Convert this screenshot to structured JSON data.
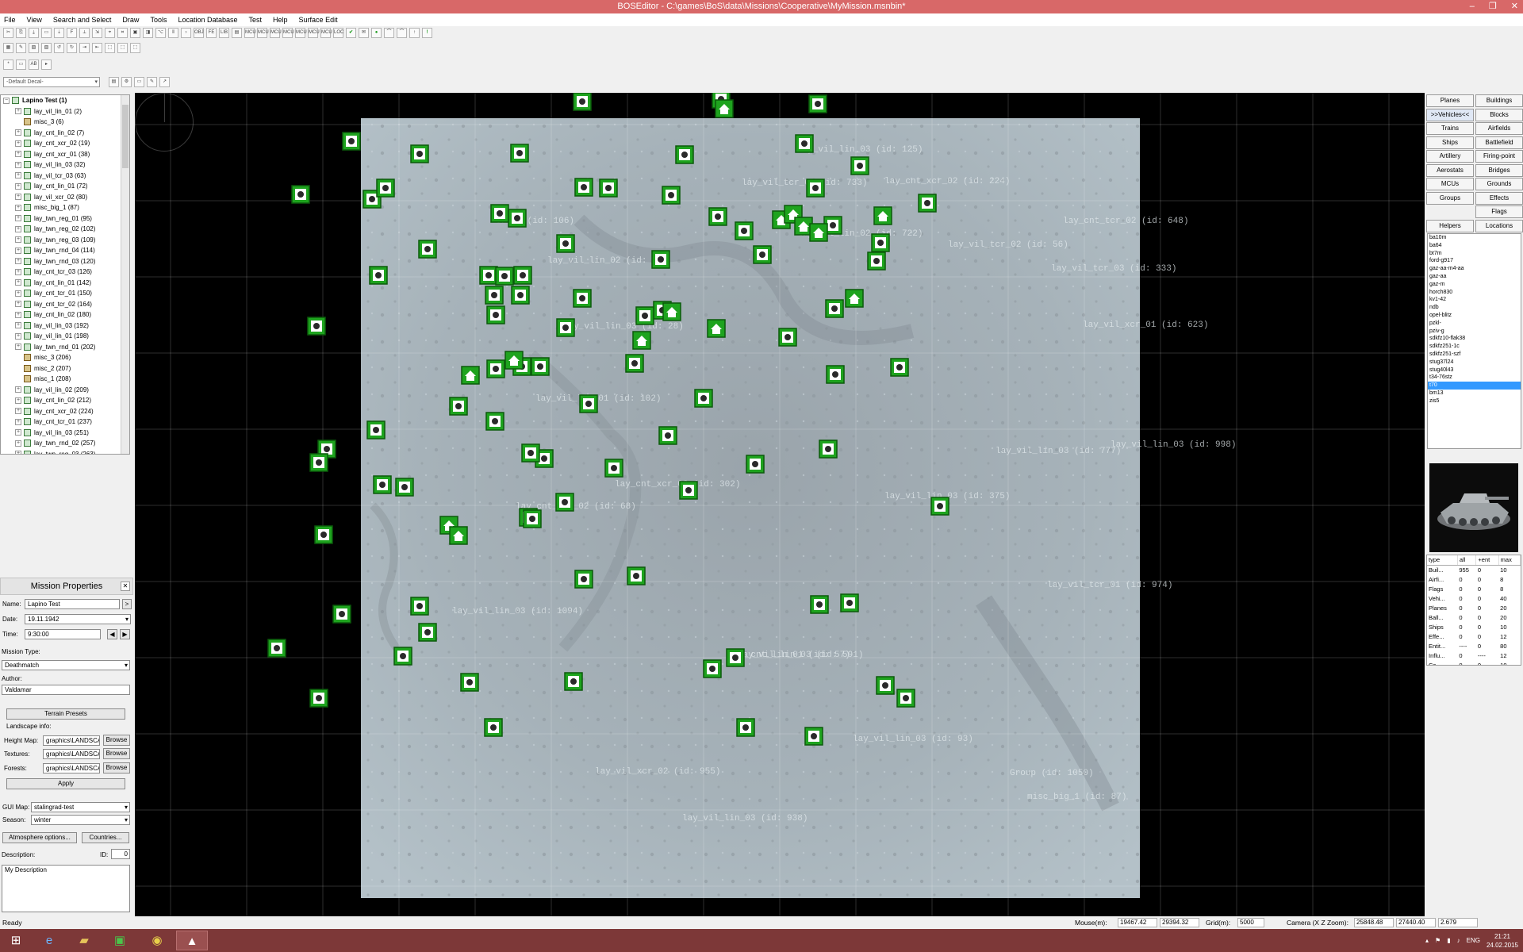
{
  "window": {
    "title": "BOSEditor - C:\\games\\BoS\\data\\Missions\\Cooperative\\MyMission.msnbin*",
    "buttons": [
      "–",
      "❐",
      "✕"
    ]
  },
  "menu": [
    "File",
    "View",
    "Search and Select",
    "Draw",
    "Tools",
    "Location Database",
    "Test",
    "Help",
    "Surface Edit"
  ],
  "toolbar1": [
    "✂",
    "⎘",
    "⤓",
    "▭",
    "⇣",
    "F",
    "⟂",
    "⇲",
    "⌖",
    "⌗",
    "▣",
    "◨",
    "⌥",
    "⫴",
    "›",
    "OBJ",
    "FE",
    "LIB",
    "▤",
    "MCU",
    "MCU",
    "MCU",
    "MCU",
    "MCU",
    "MCU",
    "MCU",
    "LOC",
    "✔",
    "✉",
    "●",
    "⌒",
    "⌒",
    "↑",
    "!"
  ],
  "toolbar2": [
    "▦",
    "✎",
    "▨",
    "▧",
    "↺",
    "↻",
    "⇥",
    "⇤",
    "⬚",
    "⬚",
    "⬚"
  ],
  "toolbar3": [
    "*",
    "▭",
    "AB",
    "▸"
  ],
  "decal_select": "-Default Decal-",
  "tree": {
    "root": "Lapino Test (1)",
    "items": [
      {
        "label": "lay_vil_lin_01 (2)",
        "exp": true
      },
      {
        "label": "misc_3 (6)",
        "exp": false
      },
      {
        "label": "lay_cnt_lin_02 (7)",
        "exp": true
      },
      {
        "label": "lay_cnt_xcr_02 (19)",
        "exp": true
      },
      {
        "label": "lay_cnt_xcr_01 (38)",
        "exp": true
      },
      {
        "label": "lay_vil_lin_03 (32)",
        "exp": true
      },
      {
        "label": "lay_vil_tcr_03 (63)",
        "exp": true
      },
      {
        "label": "lay_cnt_lin_01 (72)",
        "exp": true
      },
      {
        "label": "lay_vil_xcr_02 (80)",
        "exp": true
      },
      {
        "label": "misc_big_1 (87)",
        "exp": true
      },
      {
        "label": "lay_twn_reg_01 (95)",
        "exp": true
      },
      {
        "label": "lay_twn_reg_02 (102)",
        "exp": true
      },
      {
        "label": "lay_twn_reg_03 (109)",
        "exp": true
      },
      {
        "label": "lay_twn_rnd_04 (114)",
        "exp": true
      },
      {
        "label": "lay_twn_rnd_03 (120)",
        "exp": true
      },
      {
        "label": "lay_cnt_tcr_03 (126)",
        "exp": true
      },
      {
        "label": "lay_cnt_lin_01 (142)",
        "exp": true
      },
      {
        "label": "lay_cnt_tcr_01 (150)",
        "exp": true
      },
      {
        "label": "lay_cnt_tcr_02 (164)",
        "exp": true
      },
      {
        "label": "lay_cnt_lin_02 (180)",
        "exp": true
      },
      {
        "label": "lay_vil_lin_03 (192)",
        "exp": true
      },
      {
        "label": "lay_vil_lin_01 (198)",
        "exp": true
      },
      {
        "label": "lay_twn_rnd_01 (202)",
        "exp": true
      },
      {
        "label": "misc_3 (206)",
        "exp": false
      },
      {
        "label": "misc_2 (207)",
        "exp": false
      },
      {
        "label": "misc_1 (208)",
        "exp": false
      },
      {
        "label": "lay_vil_lin_02 (209)",
        "exp": true
      },
      {
        "label": "lay_cnt_lin_02 (212)",
        "exp": true
      },
      {
        "label": "lay_cnt_xcr_02 (224)",
        "exp": true
      },
      {
        "label": "lay_cnt_tcr_01 (237)",
        "exp": true
      },
      {
        "label": "lay_vil_lin_03 (251)",
        "exp": true
      },
      {
        "label": "lay_twn_rnd_02 (257)",
        "exp": true
      },
      {
        "label": "lay_twn_reg_03 (263)",
        "exp": true
      }
    ]
  },
  "mission_props": {
    "title": "Mission Properties",
    "name_label": "Name:",
    "name_value": "Lapino Test",
    "date_label": "Date:",
    "date_value": "19.11.1942",
    "time_label": "Time:",
    "time_value": "9:30:00",
    "mission_type_label": "Mission Type:",
    "mission_type_value": "Deathmatch",
    "author_label": "Author:",
    "author_value": "Valdamar",
    "terrain_presets": "Terrain Presets",
    "landscape_info": "Landscape info:",
    "height_map_label": "Height Map:",
    "height_map_value": "graphics\\LANDSCAPE",
    "textures_label": "Textures:",
    "textures_value": "graphics\\LANDSCAPE",
    "forests_label": "Forests:",
    "forests_value": "graphics\\LANDSCAPE",
    "browse": "Browse",
    "apply": "Apply",
    "gui_map_label": "GUI Map:",
    "gui_map_value": "stalingrad-test",
    "season_label": "Season:",
    "season_value": "winter",
    "atmosphere_button": "Atmosphere options...",
    "countries_button": "Countries...",
    "description_label": "Description:",
    "id_label": "ID:",
    "id_value": "0",
    "description_value": "My Description"
  },
  "categories": [
    [
      "Planes",
      "Buildings"
    ],
    [
      ">>Vehicles<<",
      "Blocks"
    ],
    [
      "Trains",
      "Airfields"
    ],
    [
      "Ships",
      "Battlefield"
    ],
    [
      "Artillery",
      "Firing-point"
    ],
    [
      "Aerostats",
      "Bridges"
    ],
    [
      "MCUs",
      "Grounds"
    ],
    [
      "Groups",
      "Effects"
    ],
    [
      "",
      "Flags"
    ],
    [
      "Helpers",
      "Locations"
    ]
  ],
  "vehicles": [
    "ba10m",
    "ba64",
    "bt7m",
    "ford-g917",
    "gaz-aa-m4-aa",
    "gaz-aa",
    "gaz-m",
    "horch830",
    "kv1-42",
    "ndb",
    "opel-blitz",
    "pzkl-",
    "pziv-g",
    "sdkfz10-flak38",
    "sdkfz251-1c",
    "sdkfz251-szf",
    "stug37l24",
    "stug40l43",
    "t34-76stz",
    "t70",
    "bm13",
    "zis5"
  ],
  "selected_vehicle": "t70",
  "stats": {
    "headers": [
      "type",
      "all",
      "+ent",
      "max"
    ],
    "rows": [
      [
        "Buil...",
        "955",
        "0",
        "10"
      ],
      [
        "Airfi...",
        "0",
        "0",
        "8"
      ],
      [
        "Flags",
        "0",
        "0",
        "8"
      ],
      [
        "Vehi...",
        "0",
        "0",
        "40"
      ],
      [
        "Planes",
        "0",
        "0",
        "20"
      ],
      [
        "Ball...",
        "0",
        "0",
        "20"
      ],
      [
        "Ships",
        "0",
        "0",
        "10"
      ],
      [
        "Effe...",
        "0",
        "0",
        "12"
      ],
      [
        "Entit...",
        "----",
        "0",
        "80"
      ],
      [
        "Influ...",
        "0",
        "----",
        "12"
      ],
      [
        "Ca...",
        "0",
        "0",
        "10"
      ]
    ]
  },
  "map_labels": [
    "lay_vil_lin_03 (id: 125)",
    "lay_vil_tcr_01 (id: 733)",
    "lay_cnt_xcr_02 (id: 224)",
    "lay_cnt_tcr_02 (id: 648)",
    "Group (id: 106)",
    "lay_vil_lin_02 (id: 722)",
    "lay_vil_tcr_02 (id: 56)",
    "lay_vil_lin_02 (id: 80)",
    "lay_vil_tcr_03 (id: 333)",
    "lay_vil_lin_03 (id: 28)",
    "lay_vil_xcr_01 (id: 623)",
    "lay_vil_lin_03 (id: 998)",
    "lay_vil_lin_01 (id: 102)",
    "lay_vil_lin_03 (id: 777)",
    "lay_cnt_xcr_03 (id: 302)",
    "lay_vil_lin_03 (id: 375)",
    "lay_cnt_lin_02 (id: 68)",
    "lay_vil_tcr_01 (id: 974)",
    "lay_vil_lin_03 (id: 1094)",
    "lay_cnt_lin_01 (id: 57)",
    "lay_vil_lin_03 (id: 591)",
    "lay_vil_lin_03 (id: 93)",
    "lay_vil_xcr_02 (id: 955)",
    "misc_big_1 (id: 87)",
    "Group (id: 1050)",
    "lay_vil_lin_03 (id: 938)"
  ],
  "status": {
    "ready": "Ready",
    "mouse_label": "Mouse(m):",
    "mouse_x": "19467.42",
    "mouse_z": "29394.32",
    "grid_label": "Grid(m):",
    "grid_value": "5000",
    "camera_label": "Camera (X Z Zoom):",
    "camera_x": "25848.48",
    "camera_z": "27440.40",
    "camera_zoom": "2.679"
  },
  "taskbar": {
    "lang": "ENG",
    "time": "21:21",
    "date": "24.02.2015"
  }
}
